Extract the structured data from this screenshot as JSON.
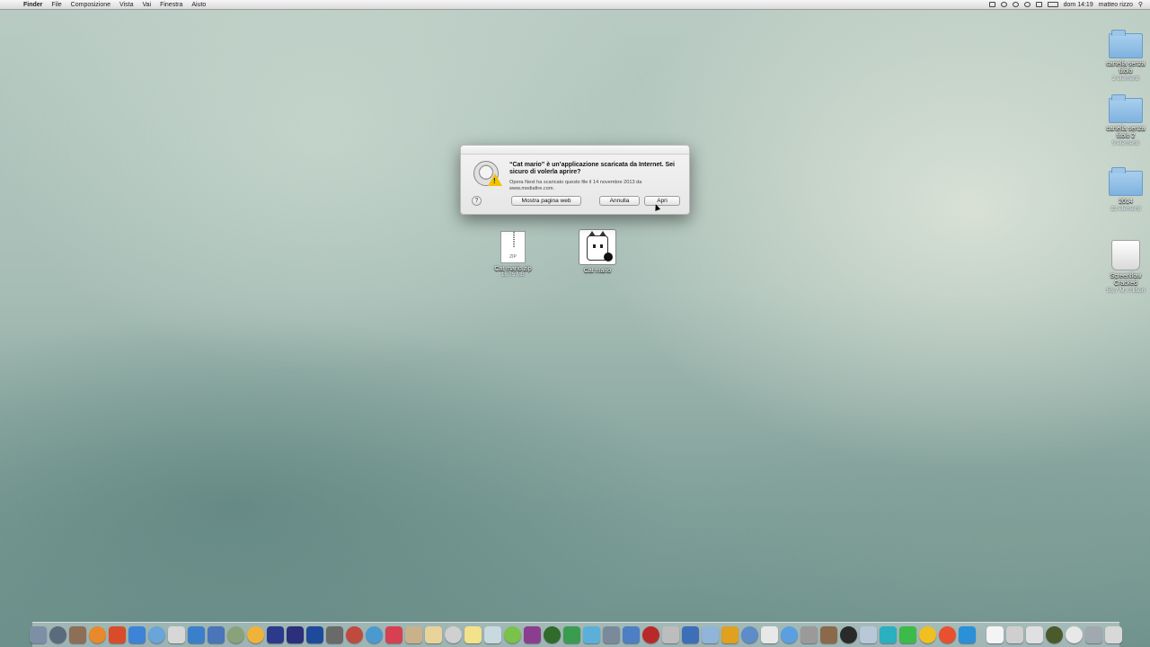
{
  "menubar": {
    "apple_glyph": "",
    "items": [
      "Finder",
      "File",
      "Composizione",
      "Vista",
      "Vai",
      "Finestra",
      "Aiuto"
    ],
    "status": {
      "clock": "dom 14:19",
      "user": "matteo rizzo"
    },
    "status_icons": [
      "camera-icon",
      "timemachine-icon",
      "bluetooth-icon",
      "wifi-icon",
      "volume-icon",
      "battery-icon"
    ]
  },
  "desktop": {
    "right_items": [
      {
        "label": "cartella senza titolo",
        "sub": "2 elementi",
        "icon": "folder-icon"
      },
      {
        "label": "cartella senza titolo 2",
        "sub": "9 elementi",
        "icon": "folder-icon"
      },
      {
        "label": "2014",
        "sub": "22 elementi",
        "icon": "folder-icon"
      },
      {
        "label": "Screenflow Cracked",
        "sub": "56,7 M, 0 liberi",
        "icon": "drive-icon"
      }
    ],
    "files": [
      {
        "label": "Cat mario.zip",
        "sub": "16,75 MB",
        "zip_text": "ZIP"
      },
      {
        "label": "Cat mario",
        "sub": ""
      }
    ]
  },
  "dialog": {
    "title": "“Cat mario” è un’applicazione scaricata da Internet. Sei sicuro di volerla aprire?",
    "message": "Opera Next ha scaricato questo file il 14 novembre 2013 da www.mediafire.com.",
    "help_label": "?",
    "show_web_label": "Mostra pagina web",
    "cancel_label": "Annulla",
    "open_label": "Apri"
  },
  "dock": {
    "colors": [
      "#7d8fa5",
      "#5a6b7e",
      "#8d6e56",
      "#e8892b",
      "#d94c2a",
      "#3d83d8",
      "#6aa5d9",
      "#d7d7d7",
      "#3a7fcc",
      "#4a75b8",
      "#8aa27a",
      "#f0b33a",
      "#2c3a8c",
      "#2b2f7c",
      "#1e4a9c",
      "#6a6a6a",
      "#c04a3e",
      "#4a9ad0",
      "#d64050",
      "#c9b28a",
      "#e8d49a",
      "#d0d0d0",
      "#f2e28a",
      "#c9d9e0",
      "#7ac24a",
      "#8b3e8f",
      "#2f6b2a",
      "#3a9c4e",
      "#5ab0d8",
      "#7a8a9a",
      "#4e7fc4",
      "#b82a2a",
      "#bdbdbd",
      "#3d6fb8",
      "#8fb5d8",
      "#e0a020",
      "#5d8cc8",
      "#e8e8e8",
      "#5aa0e0",
      "#9a9a9a",
      "#8a6a4a",
      "#2a2a2a",
      "#b8c8d8",
      "#2ab0c0",
      "#3cba4a",
      "#f0c020",
      "#e85030",
      "#2a90d8",
      "#f4f4f4",
      "#cfcfcf",
      "#e0e0e0",
      "#4a5a2a",
      "#e8e8e8",
      "#a0a8b0",
      "#d8d8d8",
      "#9aa0a8"
    ],
    "icons": [
      "finder-icon",
      "launchpad-icon",
      "mission-control-icon",
      "vlc-icon",
      "firefox-icon",
      "chrome-icon",
      "safari-icon",
      "opera-icon",
      "mail-icon",
      "preview-icon",
      "maps-icon",
      "photos-icon",
      "aftereffects-icon",
      "photoshop-icon",
      "prompt-icon",
      "games-icon",
      "xcode-icon",
      "books-icon",
      "notes-icon",
      "calendar-icon",
      "stickies-icon",
      "textedit-icon",
      "keychain-icon",
      "minecraft-icon",
      "disk-icon",
      "xbox-icon",
      "tunnelbear-icon",
      "messages-icon",
      "settings-icon",
      "appstore-icon",
      "flash-icon",
      "safari2-icon",
      "itunes-icon",
      "mac-icon",
      "cleaner-icon",
      "sysprefs-icon",
      "cat-mario-icon",
      "network-icon",
      "compass-icon",
      "terminal-icon",
      "tools-icon",
      "activity-icon",
      "ccleaner-icon",
      "excel-icon",
      "vlc2-icon",
      "powerpoint-icon",
      "word-icon",
      "cat-icon",
      "help-icon",
      "document-icon",
      "folder-icon",
      "minecraft2-icon",
      "info-icon",
      "drive-icon",
      "trash-icon"
    ]
  }
}
